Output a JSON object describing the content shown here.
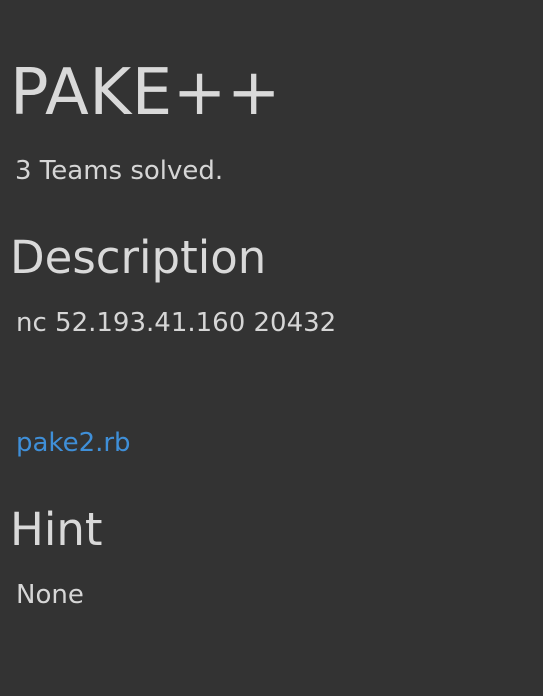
{
  "challenge": {
    "title": "PAKE++",
    "solved_text": "3 Teams solved."
  },
  "description": {
    "heading": "Description",
    "text": "nc 52.193.41.160 20432",
    "attachment_label": "pake2.rb"
  },
  "hint": {
    "heading": "Hint",
    "text": "None"
  },
  "colors": {
    "background": "#333333",
    "text": "#d6d6d6",
    "link": "#3f8fd8"
  }
}
